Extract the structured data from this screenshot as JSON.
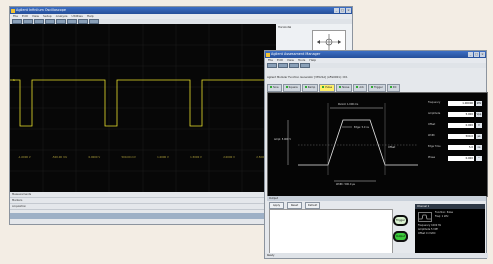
{
  "scope": {
    "title": "Agilent Infiniium Oscilloscope",
    "menu": [
      "File",
      "Edit",
      "View",
      "Setup",
      "Analyze",
      "Utilities",
      "Help"
    ],
    "side_header": "Horizontal",
    "bottom_rows": [
      "Measurements",
      "Markers",
      "Acquisition"
    ],
    "y_labels": [
      "-1.0000 V",
      "-500.00 mV",
      "0.0000 V",
      "500.00 mV",
      "1.0000 V",
      "1.5000 V",
      "2.0000 V",
      "2.5000 V"
    ]
  },
  "asm": {
    "title": "Agilent Assessment Manager",
    "menu": [
      "File",
      "Edit",
      "View",
      "Tools",
      "Help"
    ],
    "subtitle": "Agilent Modular Function Generator [33521A] (AFG0001): Ch1",
    "tabs": [
      {
        "label": "Sine",
        "active": false
      },
      {
        "label": "Square",
        "active": false
      },
      {
        "label": "Ramp",
        "active": false
      },
      {
        "label": "Pulse",
        "active": true
      },
      {
        "label": "Noise",
        "active": false
      },
      {
        "label": "Arb",
        "active": false
      },
      {
        "label": "Trigger",
        "active": false
      },
      {
        "label": "DC",
        "active": false
      }
    ],
    "waveform_labels": {
      "period": "Period: 1.000 ms",
      "width": "Width: 500.0 µs",
      "amplitude": "Ampl: 5.000 V",
      "offset": "Offset",
      "edge": "Edge: 5.0 ns"
    },
    "params": [
      {
        "label": "Frequency",
        "value": "1.00000",
        "unit": "kHz"
      },
      {
        "label": "Amplitude",
        "value": "5.000",
        "unit": "Vpp"
      },
      {
        "label": "Offset",
        "value": "0.000",
        "unit": "V"
      },
      {
        "label": "Width",
        "value": "500.0",
        "unit": "µs"
      },
      {
        "label": "Edge Time",
        "value": "5.0",
        "unit": "ns"
      },
      {
        "label": "Phase",
        "value": "0.000",
        "unit": "°"
      }
    ],
    "bottom_bar": "Output",
    "buttons": [
      "Apply",
      "Reset",
      "Default"
    ],
    "round_buttons": [
      "Trigger",
      "Output"
    ],
    "info": {
      "header": "Channel 1",
      "line1": "Function: Pulse",
      "line2": "Freq: 1 kHz",
      "freq_label": "Frequency",
      "freq_val": "1000 Hz",
      "ampl_label": "Amplitude",
      "ampl_val": "5 VPP",
      "offs_label": "Offset",
      "offs_val": "0 mVDC"
    },
    "status": "Ready"
  }
}
